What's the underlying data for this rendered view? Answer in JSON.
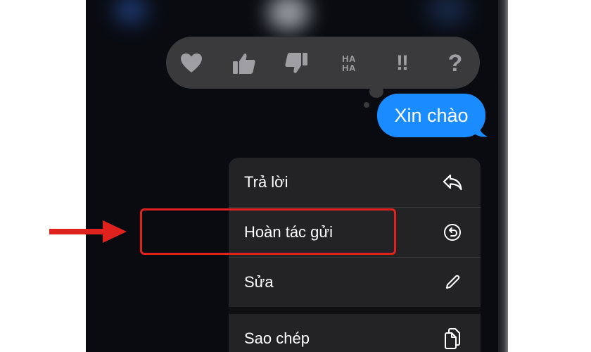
{
  "tapback": {
    "reactions": [
      {
        "icon": "heart-icon"
      },
      {
        "icon": "thumbs-up-icon"
      },
      {
        "icon": "thumbs-down-icon"
      },
      {
        "icon": "haha-icon",
        "text_top": "HA",
        "text_bottom": "HA"
      },
      {
        "icon": "exclamation-icon",
        "text": "!!"
      },
      {
        "icon": "question-icon",
        "text": "?"
      }
    ]
  },
  "message": {
    "text": "Xin chào",
    "color": "#1a8cff"
  },
  "context_menu": {
    "items": [
      {
        "label": "Trả lời",
        "icon": "reply-icon"
      },
      {
        "label": "Hoàn tác gửi",
        "icon": "undo-send-icon"
      },
      {
        "label": "Sửa",
        "icon": "pencil-icon"
      },
      {
        "label": "Sao chép",
        "icon": "copy-icon"
      }
    ]
  },
  "annotation": {
    "highlight_color": "#e0221e"
  }
}
